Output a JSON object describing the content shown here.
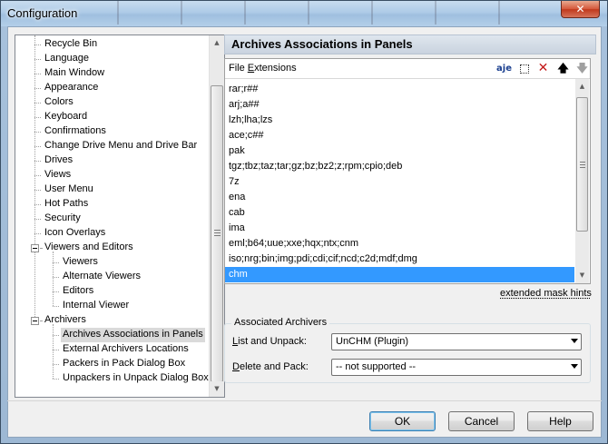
{
  "window": {
    "title": "Configuration",
    "close_symbol": "✕"
  },
  "tree": {
    "items": [
      {
        "label": "Recycle Bin"
      },
      {
        "label": "Language"
      },
      {
        "label": "Main Window"
      },
      {
        "label": "Appearance"
      },
      {
        "label": "Colors"
      },
      {
        "label": "Keyboard"
      },
      {
        "label": "Confirmations"
      },
      {
        "label": "Change Drive Menu and Drive Bar"
      },
      {
        "label": "Drives"
      },
      {
        "label": "Views"
      },
      {
        "label": "User Menu"
      },
      {
        "label": "Hot Paths"
      },
      {
        "label": "Security"
      },
      {
        "label": "Icon Overlays"
      },
      {
        "label": "Viewers and Editors"
      },
      {
        "label": "Viewers"
      },
      {
        "label": "Alternate Viewers"
      },
      {
        "label": "Editors"
      },
      {
        "label": "Internal Viewer"
      },
      {
        "label": "Archivers"
      },
      {
        "label": "Archives Associations in Panels"
      },
      {
        "label": "External Archivers Locations"
      },
      {
        "label": "Packers in Pack Dialog Box"
      },
      {
        "label": "Unpackers in Unpack Dialog Box"
      }
    ],
    "selected_index": 20
  },
  "panel": {
    "title": "Archives Associations in Panels"
  },
  "extensions": {
    "header_pre": "File ",
    "header_accel": "E",
    "header_post": "xtensions",
    "toolbar_icons": [
      "rename-icon",
      "new-item-icon",
      "delete-icon",
      "move-up-icon",
      "move-down-icon"
    ],
    "items": [
      "rar;r##",
      "arj;a##",
      "lzh;lha;lzs",
      "ace;c##",
      "pak",
      "tgz;tbz;taz;tar;gz;bz;bz2;z;rpm;cpio;deb",
      "7z",
      "ena",
      "cab",
      "ima",
      "eml;b64;uue;xxe;hqx;ntx;cnm",
      "iso;nrg;bin;img;pdi;cdi;cif;ncd;c2d;mdf;dmg",
      "chm"
    ],
    "selected_index": 12,
    "hint_link": "extended mask hints"
  },
  "associated": {
    "legend": "Associated Archivers",
    "list_unpack_pre": "",
    "list_unpack_accel": "L",
    "list_unpack_post": "ist and Unpack:",
    "list_unpack_value": "UnCHM (Plugin)",
    "delete_pack_pre": "",
    "delete_pack_accel": "D",
    "delete_pack_post": "elete and Pack:",
    "delete_pack_value": "-- not supported --"
  },
  "buttons": {
    "ok": "OK",
    "cancel": "Cancel",
    "help": "Help"
  },
  "colors": {
    "selection": "#3399ff",
    "header_bg": "#c9d3df"
  }
}
